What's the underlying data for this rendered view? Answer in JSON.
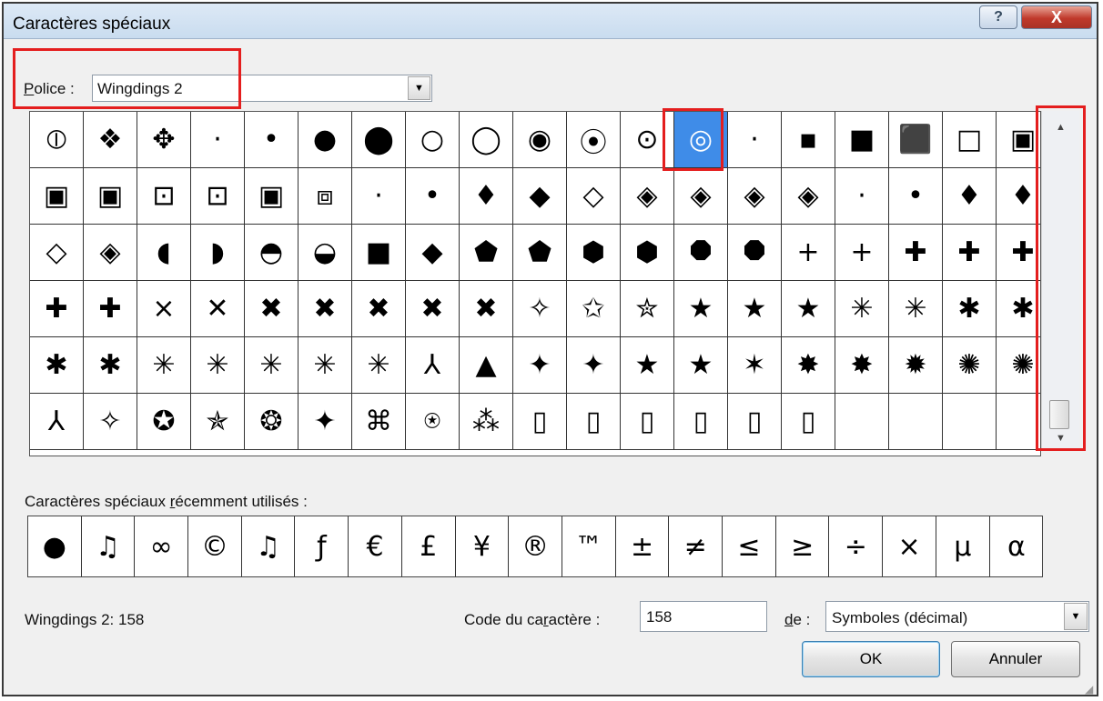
{
  "dialog": {
    "title": "Caractères spéciaux"
  },
  "titlebar": {
    "help_icon": "?",
    "close_icon": "X"
  },
  "font": {
    "label_prefix": "P",
    "label_rest": "olice :",
    "value": "Wingdings 2"
  },
  "grid": {
    "selected_index": 12,
    "rows": [
      [
        "⦶",
        "❖",
        "✥",
        "·",
        "•",
        "●",
        "⬤",
        "○",
        "◯",
        "◉",
        "⦿",
        "⊙",
        "◎",
        "·",
        "▪",
        "■",
        "⬛",
        "□",
        "▣"
      ],
      [
        "▣",
        "▣",
        "⊡",
        "⊡",
        "▣",
        "⧈",
        "·",
        "•",
        "♦",
        "◆",
        "◇",
        "◈",
        "◈",
        "◈",
        "◈",
        "·",
        "•",
        "♦",
        "♦"
      ],
      [
        "◇",
        "◈",
        "◖",
        "◗",
        "◓",
        "◒",
        "■",
        "◆",
        "⬟",
        "⬟",
        "⬢",
        "⬢",
        "⯃",
        "⯃",
        "+",
        "+",
        "✚",
        "✚",
        "✚"
      ],
      [
        "✚",
        "✚",
        "×",
        "✕",
        "✖",
        "✖",
        "✖",
        "✖",
        "✖",
        "✧",
        "✩",
        "✮",
        "★",
        "★",
        "★",
        "✳",
        "✳",
        "✱",
        "✱"
      ],
      [
        "✱",
        "✱",
        "✳",
        "✳",
        "✳",
        "✳",
        "✳",
        "⅄",
        "▲",
        "✦",
        "✦",
        "★",
        "★",
        "✶",
        "✸",
        "✸",
        "✹",
        "✺",
        "✺"
      ],
      [
        "⅄",
        "✧",
        "✪",
        "✯",
        "❂",
        "✦",
        "⌘",
        "⍟",
        "⁂",
        "▯",
        "▯",
        "▯",
        "▯",
        "▯",
        "▯",
        "",
        "",
        "",
        ""
      ]
    ]
  },
  "recent": {
    "label_before": "Caractères spéciaux ",
    "label_underline": "r",
    "label_after": "écemment utilisés :",
    "items": [
      "●",
      "♫",
      "∞",
      "©",
      "♫",
      "ƒ",
      "€",
      "£",
      "¥",
      "®",
      "™",
      "±",
      "≠",
      "≤",
      "≥",
      "÷",
      "×",
      "µ",
      "α"
    ]
  },
  "status": {
    "text": "Wingdings 2: 158"
  },
  "code": {
    "label_before": "Code du ca",
    "label_underline": "r",
    "label_after": "actère :",
    "value": "158"
  },
  "from": {
    "label_underline": "d",
    "label_after": "e :",
    "value": "Symboles (décimal)"
  },
  "buttons": {
    "ok": "OK",
    "cancel": "Annuler"
  },
  "icons": {
    "dropdown": "chevron-down-icon",
    "scroll_up": "scroll-up-arrow-icon",
    "scroll_down": "scroll-down-arrow-icon",
    "help": "help-icon",
    "close": "close-icon"
  },
  "colors": {
    "selection": "#3f8ce8",
    "highlight_box": "#e41e1e",
    "close_button": "#c0392b"
  }
}
